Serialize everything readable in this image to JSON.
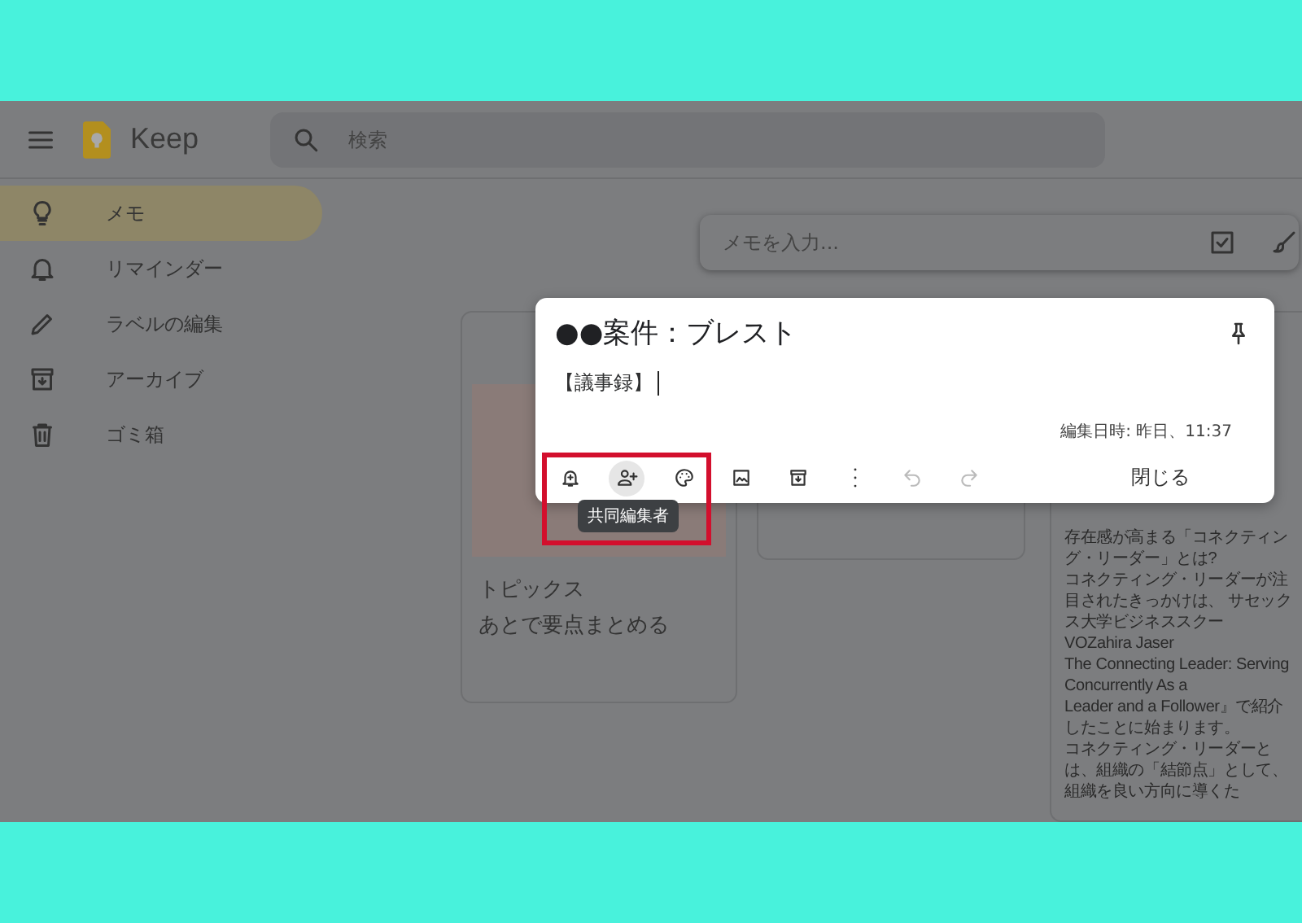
{
  "header": {
    "app_name": "Keep",
    "search": {
      "placeholder": "検索"
    }
  },
  "sidebar": {
    "items": [
      {
        "label": "メモ",
        "kind": "bulb",
        "selected": true
      },
      {
        "label": "リマインダー",
        "kind": "bell",
        "selected": false
      },
      {
        "label": "ラベルの編集",
        "kind": "pencil",
        "selected": false
      },
      {
        "label": "アーカイブ",
        "kind": "archive",
        "selected": false
      },
      {
        "label": "ゴミ箱",
        "kind": "trash",
        "selected": false
      }
    ]
  },
  "note_input": {
    "placeholder": "メモを入力..."
  },
  "cards": [
    {
      "kind": "image_note",
      "lines": [
        "トピックス",
        "あとで要点まとめる"
      ]
    },
    {
      "kind": "blank"
    },
    {
      "kind": "text",
      "lines": [
        "存在感が高まる「コネクティン",
        "グ・リーダー」とは?",
        "コネクティング・リーダーが注",
        "目されたきっかけは、 サセック",
        "ス大学ビジネススクー",
        "VOZahira Jaser",
        "The Connecting Leader: Serving",
        "Concurrently As a",
        "Leader and a Follower』で紹介",
        "したことに始まります。",
        "コネクティング・リーダーと",
        "は、組織の「結節点」として、",
        "組織を良い方向に導くた"
      ]
    }
  ],
  "editor": {
    "title": "●●案件：ブレスト",
    "body": "【議事録】",
    "edited": "編集日時: 昨日、11:37",
    "toolbar": [
      {
        "kind": "reminder",
        "hovered": false,
        "disabled": false
      },
      {
        "kind": "collaborator",
        "hovered": true,
        "disabled": false
      },
      {
        "kind": "palette",
        "hovered": false,
        "disabled": false
      },
      {
        "kind": "image",
        "hovered": false,
        "disabled": false
      },
      {
        "kind": "archive",
        "hovered": false,
        "disabled": false
      },
      {
        "kind": "more",
        "hovered": false,
        "disabled": false
      },
      {
        "kind": "undo",
        "hovered": false,
        "disabled": true
      },
      {
        "kind": "redo",
        "hovered": false,
        "disabled": true
      }
    ],
    "tooltip": "共同編集者",
    "close_button": "閉じる"
  }
}
